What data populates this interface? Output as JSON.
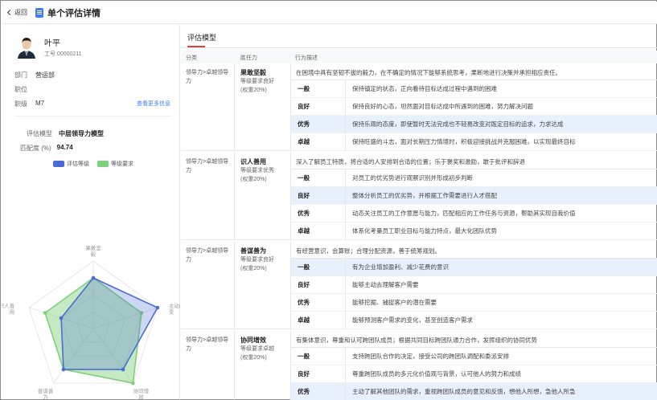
{
  "header": {
    "back_label": "返回",
    "title": "单个评估详情"
  },
  "employee": {
    "name": "叶平",
    "id_text": "工号:00000211",
    "fields": [
      {
        "key": "部门",
        "value": "营运部"
      },
      {
        "key": "职位",
        "value": ""
      },
      {
        "key": "职级",
        "value": "M7"
      }
    ],
    "more_link": "查看更多信息"
  },
  "evaluation": {
    "model_label": "评估模型",
    "model_value": "中层领导力模型",
    "match_label": "匹配度 (%)",
    "match_value": "94.74",
    "legend": [
      {
        "name": "评估等级",
        "color": "#4a6cd4"
      },
      {
        "name": "等级要求",
        "color": "#7fd07a"
      }
    ]
  },
  "chart_data": {
    "type": "radar",
    "axes": [
      "果敢坚毅",
      "主动改变",
      "协同增效",
      "善谋善为",
      "识人善用"
    ],
    "axis_labels_visible": [
      "果敢坚\n毅",
      "主动改\n变",
      "协同增\n效",
      "善谋善\n为",
      "识人善\n用"
    ],
    "series": [
      {
        "name": "评估等级",
        "values": [
          3,
          4,
          3,
          3,
          2
        ],
        "color": "#4a6cd4"
      },
      {
        "name": "等级要求",
        "values": [
          3,
          3,
          4,
          3,
          3
        ],
        "color": "#7fd07a"
      }
    ],
    "max": 4
  },
  "tabs": [
    {
      "label": "评估模型"
    }
  ],
  "table": {
    "headers": [
      "分类",
      "胜任力",
      "行为描述"
    ],
    "groups": [
      {
        "category": "领导力>卓越领导力",
        "competency": "果敢坚毅",
        "requirement": "等级要求良好",
        "weight": "(权重20%)",
        "description": "在困境中具有坚韧不拔的毅力，在不确定的情况下能够系统思考，果断地进行决策并承担相应责任。",
        "levels": [
          {
            "name": "一般",
            "text": "保持镇定的状态，正向看待目标达成过程中遇到的困难",
            "highlight": false
          },
          {
            "name": "良好",
            "text": "保持良好的心态，坦然面对目标达成中所遇到的困难，努力解决问题",
            "highlight": false
          },
          {
            "name": "优秀",
            "text": "保持乐观的态度，即使暂时无法完成也不轻易改变对既定目标的追求，力求达成",
            "highlight": true
          },
          {
            "name": "卓越",
            "text": "保持旺盛的斗志，面对长期压力情境时，积极迎接挑战并克服困难，以实现最终目标",
            "highlight": false
          }
        ]
      },
      {
        "category": "领导力>卓越领导力",
        "competency": "识人善用",
        "requirement": "等级要求优秀",
        "weight": "(权重20%)",
        "description": "深入了解员工特质，将合适的人安排到合适的位置；乐于褒奖和激励，敢于批评和辞退",
        "levels": [
          {
            "name": "一般",
            "text": "对员工的优劣势进行观察识别并形成初步判断",
            "highlight": false
          },
          {
            "name": "良好",
            "text": "整体分析员工的优劣势，并根据工作需要进行人才搭配",
            "highlight": true
          },
          {
            "name": "优秀",
            "text": "动态关注员工的工作意愿与能力，匹配相应的工作任务与资源，帮助其实现自我价值",
            "highlight": false
          },
          {
            "name": "卓越",
            "text": "体系化考量员工职业目标与能力特点，最大化团队优势",
            "highlight": false
          }
        ]
      },
      {
        "category": "领导力>卓越领导力",
        "competency": "善谋善为",
        "requirement": "等级要求良好",
        "weight": "(权重20%)",
        "description": "有经营意识，会算账；合理分配资源，善于统筹规划。",
        "levels": [
          {
            "name": "一般",
            "text": "有为企业增加盈利、减少花费的意识",
            "highlight": true
          },
          {
            "name": "良好",
            "text": "能够主动去理解客户需要",
            "highlight": false
          },
          {
            "name": "优秀",
            "text": "能够挖掘、捕捉客户的潜在需要",
            "highlight": false
          },
          {
            "name": "卓越",
            "text": "能够预测客户需求的变化，甚至创造客户需求",
            "highlight": false
          }
        ]
      },
      {
        "category": "领导力>卓越领导力",
        "competency": "协同增效",
        "requirement": "等级要求卓越",
        "weight": "(权重20%)",
        "description": "有集体意识，尊重和认可跨团队成员；根据共同目标跨团队通力合作，发挥组织的协同优势",
        "levels": [
          {
            "name": "一般",
            "text": "支持跨团队合作的决定，接受公司的跨团队调配和委派安排",
            "highlight": false
          },
          {
            "name": "良好",
            "text": "尊重跨团队成员的多元化价值观与背景，认可他人的努力和成绩",
            "highlight": false
          },
          {
            "name": "优秀",
            "text": "主动了解其他团队的需求，重视跨团队成员的意见和反馈，想他人所想，急他人所急",
            "highlight": true
          }
        ]
      }
    ]
  }
}
